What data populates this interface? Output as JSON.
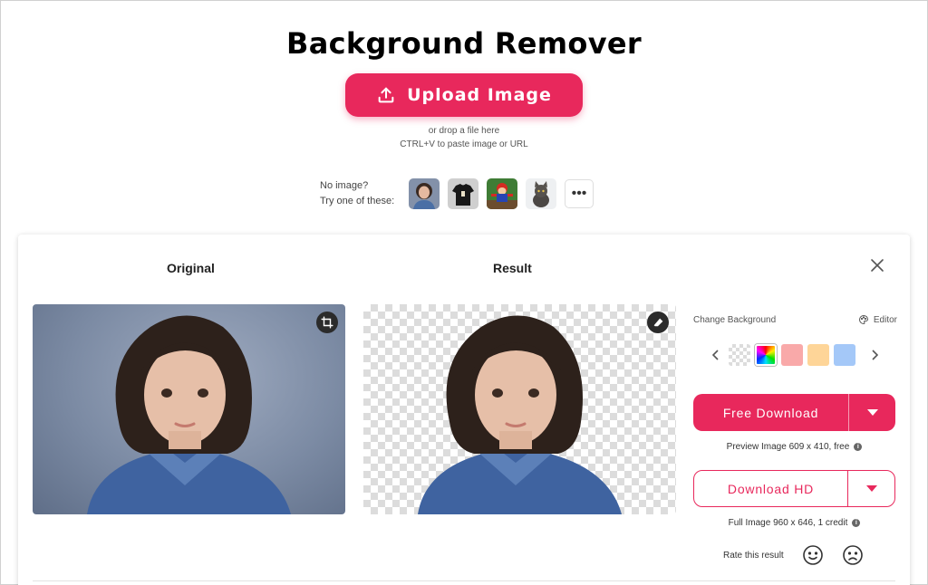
{
  "page": {
    "title": "Background Remover",
    "upload_label": "Upload Image",
    "drop_hint": "or drop a file here",
    "paste_hint": "CTRL+V to paste image or URL"
  },
  "samples": {
    "line1": "No image?",
    "line2": "Try one of these:",
    "items": [
      "girl-portrait",
      "black-tshirt",
      "toy-figure",
      "kitten"
    ],
    "more_label": "•••"
  },
  "panel": {
    "original_label": "Original",
    "result_label": "Result",
    "change_background_label": "Change Background",
    "editor_label": "Editor",
    "swatch_colors": [
      "transparent",
      "rainbow",
      "#f9a9a9",
      "#fed598",
      "#a4c8f8"
    ],
    "free_download_label": "Free Download",
    "preview_note": "Preview Image 609 x 410, free",
    "download_hd_label": "Download HD",
    "full_note": "Full Image 960 x 646, 1 credit",
    "rate_label": "Rate this result"
  },
  "colors": {
    "accent": "#e8285c",
    "original_background": "#7c8ba4"
  }
}
